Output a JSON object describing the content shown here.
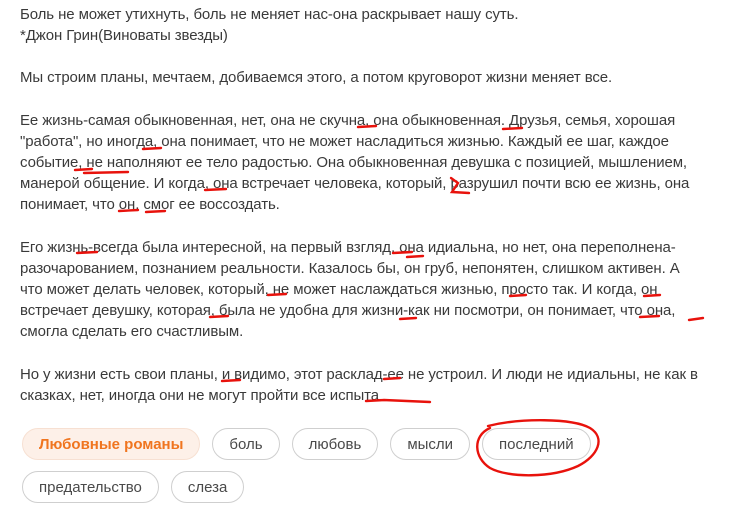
{
  "post": {
    "quote": [
      "Боль не может утихнуть, боль не меняет нас-она раскрывает нашу суть.",
      "*Джон Грин(Виноваты звезды)"
    ],
    "p1": [
      "Мы строим планы, мечтаем, добиваемся этого, а потом круговорот жизни меняет все."
    ],
    "p2": [
      "Ее жизнь-самая обыкновенная, нет, она не скучна, она обыкновенная. Друзья, семья, хорошая",
      "\"работа\", но иногда, она понимает, что не может насладиться жизнью. Каждый ее шаг, каждое",
      "событие, не наполняют ее тело радостью. Она обыкновенная девушка с позицией, мышлением,",
      "манерой общение. И когда, она встречает человека, который, разрушил почти всю ее жизнь, она",
      "понимает, что он, смог ее воссоздать."
    ],
    "p3": [
      "Его жизнь-всегда была интересной, на первый взгляд, она идиальна, но нет, она переполнена-",
      "разочарованием, познанием реальности. Казалось бы, он груб, непонятен, слишком активен. А",
      "что может делать человек, который, не может наслаждаться жизнью, просто так. И когда, он",
      "встречает девушку, которая, была не удобна для жизни-как ни посмотри, он понимает, что она,",
      "смогла сделать его счастливым."
    ],
    "p4": [
      "Но у жизни есть свои планы, и видимо, этот расклад-ее не устроил. И люди не идиальны, не как в",
      "сказках, нет, иногда они не могут пройти все испыта"
    ]
  },
  "tags": {
    "featured": "Любовные романы",
    "row1": [
      "боль",
      "любовь",
      "мысли",
      "последний"
    ],
    "row2": [
      "предательство",
      "слеза"
    ]
  },
  "colors": {
    "annotation": "#e8120c",
    "featured_text": "#f0751f",
    "featured_bg": "#fdf0e8",
    "text": "#3a3a3a"
  }
}
